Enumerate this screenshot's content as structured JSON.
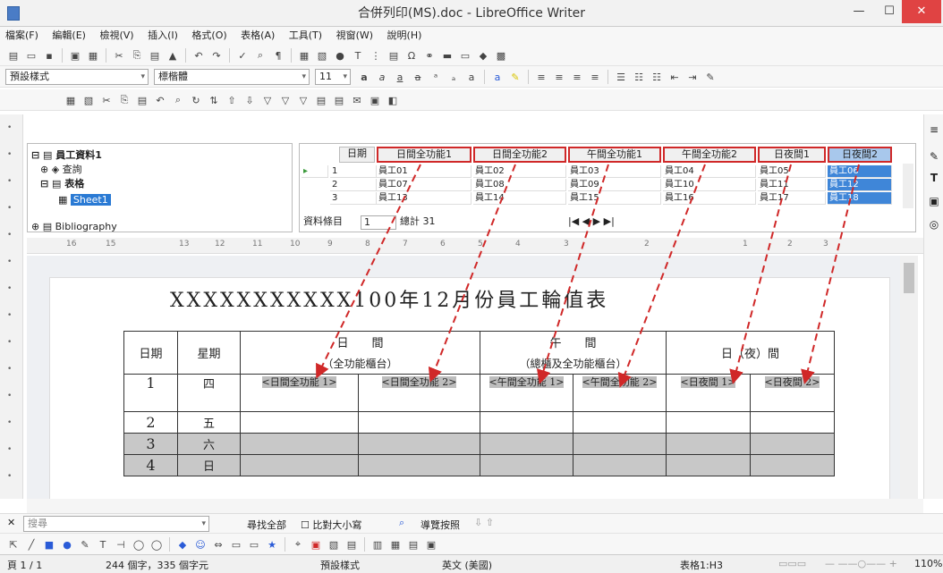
{
  "window": {
    "title": "合併列印(MS).doc - LibreOffice Writer",
    "min": "—",
    "max": "☐",
    "close": "✕"
  },
  "menu": [
    "檔案(F)",
    "編輯(E)",
    "檢視(V)",
    "插入(I)",
    "格式(O)",
    "表格(A)",
    "工具(T)",
    "視窗(W)",
    "說明(H)"
  ],
  "format_bar": {
    "style": "預設樣式",
    "font": "標楷體",
    "size": "11"
  },
  "navigator": {
    "root": "員工資料1",
    "query": "查詢",
    "tables": "表格",
    "sheet": "Sheet1",
    "biblio": "Bibliography"
  },
  "grid": {
    "headers": [
      "日期",
      "日間全功能1",
      "日間全功能2",
      "午間全功能1",
      "午間全功能2",
      "日夜間1",
      "日夜間2"
    ],
    "rows": [
      [
        "1",
        "員工01",
        "員工02",
        "員工03",
        "員工04",
        "員工05",
        "員工06"
      ],
      [
        "2",
        "員工07",
        "員工08",
        "員工09",
        "員工10",
        "員工11",
        "員工12"
      ],
      [
        "3",
        "員工13",
        "員工14",
        "員工15",
        "員工16",
        "員工17",
        "員工18"
      ]
    ],
    "record_label": "資料條目",
    "record_value": "1",
    "total": "總計 31"
  },
  "ruler": [
    "16",
    "15",
    "13",
    "12",
    "11",
    "10",
    "9",
    "8",
    "7",
    "6",
    "5",
    "4",
    "3",
    "2",
    "1",
    "2",
    "3"
  ],
  "doc": {
    "title": "XXXXXXXXXXX100年12月份員工輪值表",
    "col_date": "日期",
    "col_week": "星期",
    "day_head": "日　　間",
    "day_sub": "（全功能櫃台）",
    "noon_head": "午　　間",
    "noon_sub": "（總櫃及全功能櫃台）",
    "night_head": "日（夜）間",
    "row1_date": "1",
    "row1_week": "四",
    "f1": "<日間全功能 1>",
    "f2": "<日間全功能 2>",
    "f3": "<午間全功能 1>",
    "f4": "<午間全功能 2>",
    "f5": "<日夜間 1>",
    "f6": "<日夜間 2>",
    "rows": [
      [
        "2",
        "五"
      ],
      [
        "3",
        "六"
      ],
      [
        "4",
        "日"
      ]
    ]
  },
  "find": {
    "placeholder": "搜尋",
    "find_all": "尋找全部",
    "match_case": "比對大小寫",
    "nav": "導覽按照"
  },
  "status": {
    "page": "頁 1 / 1",
    "words": "244 個字，335 個字元",
    "style": "預設樣式",
    "lang": "英文 (美國)",
    "cell": "表格1:H3",
    "zoom": "110%"
  }
}
